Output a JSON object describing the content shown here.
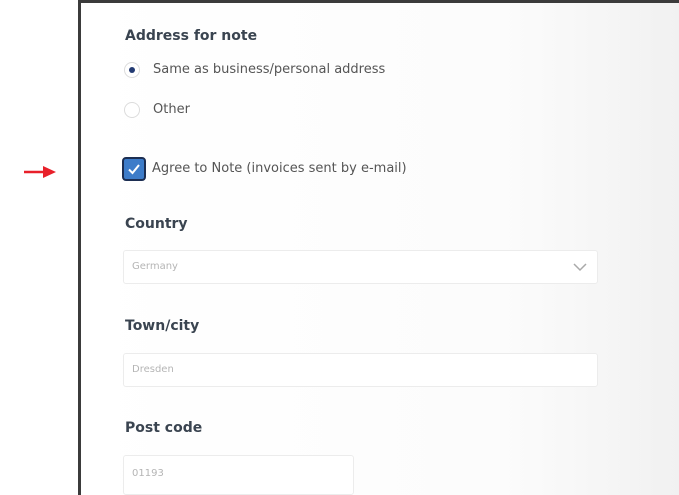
{
  "address_section": {
    "label": "Address for note",
    "options": [
      {
        "label": "Same as business/personal address",
        "selected": true
      },
      {
        "label": "Other",
        "selected": false
      }
    ]
  },
  "agree_checkbox": {
    "label": "Agree to Note (invoices sent by e-mail)",
    "checked": true
  },
  "country": {
    "label": "Country",
    "value": "Germany",
    "icon": "chevron-down-icon"
  },
  "town": {
    "label": "Town/city",
    "value": "Dresden"
  },
  "post_code": {
    "label": "Post code",
    "value": "01193"
  },
  "colors": {
    "annotation_arrow": "#e8202a",
    "checkbox_fill": "#3d7cc9",
    "radio_dot": "#233a72",
    "label_text": "#3a4450"
  }
}
